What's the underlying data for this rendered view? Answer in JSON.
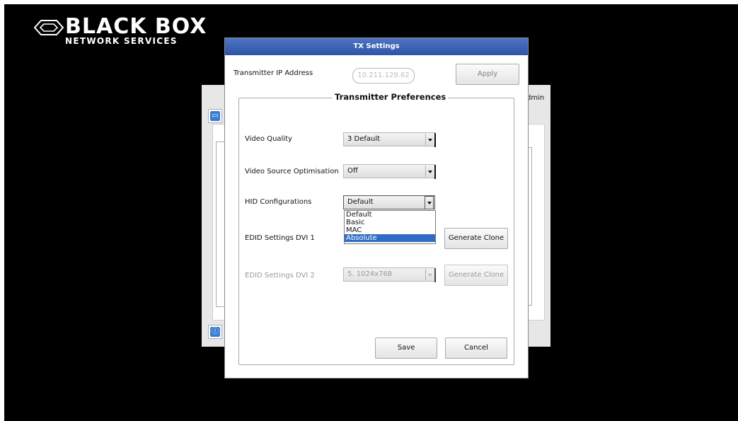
{
  "brand": {
    "name": "BLACK BOX",
    "tagline": "NETWORK SERVICES",
    "color": "#ffffff"
  },
  "background_window": {
    "user_fragment": "dmin"
  },
  "dialog": {
    "title": "TX Settings",
    "ip_label": "Transmitter IP Address",
    "ip_value": "10.211.129.62",
    "apply_label": "Apply",
    "group_title": "Transmitter Preferences",
    "video_quality": {
      "label": "Video Quality",
      "value": "3 Default"
    },
    "video_source": {
      "label": "Video Source Optimisation",
      "value": "Off"
    },
    "hid": {
      "label": "HID Configurations",
      "value": "Default",
      "options": [
        "Default",
        "Basic",
        "MAC",
        "Absolute"
      ],
      "highlighted": "Absolute"
    },
    "edid1": {
      "label": "EDID Settings  DVI 1",
      "button": "Generate Clone"
    },
    "edid2": {
      "label": "EDID Settings  DVI 2",
      "value": "5. 1024x768",
      "button": "Generate Clone"
    },
    "save_label": "Save",
    "cancel_label": "Cancel"
  },
  "colors": {
    "titlebar": "#3a60b4",
    "selection": "#2f6dc4",
    "screen_bg": "#000000"
  }
}
